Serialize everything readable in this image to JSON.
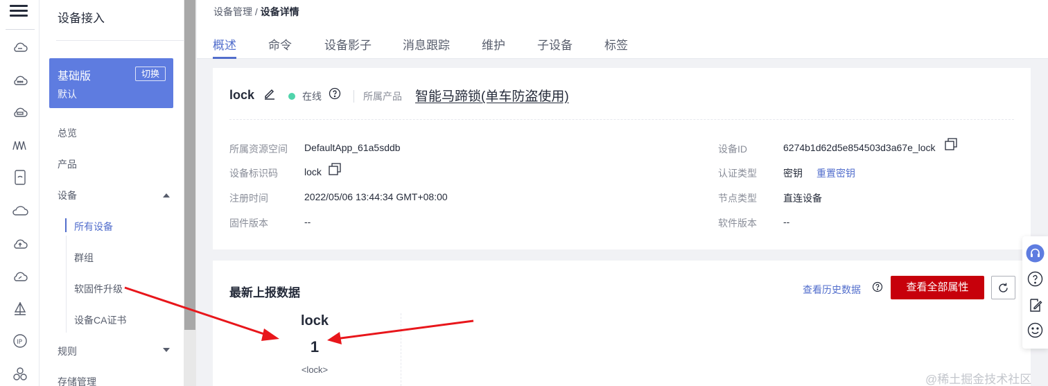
{
  "rail": {
    "icons": [
      "menu-icon",
      "cloud-icon",
      "cloud-dots-icon",
      "cloud-server-icon",
      "wave-icon",
      "device-icon",
      "cloud-outline-icon",
      "cloud-upload-icon",
      "cloud-link-icon",
      "sail-icon",
      "ip-icon",
      "cluster-icon"
    ]
  },
  "menu": {
    "title": "设备接入",
    "edition": {
      "name": "基础版",
      "switch_label": "切换",
      "default_label": "默认"
    },
    "items": [
      {
        "label": "总览"
      },
      {
        "label": "产品"
      },
      {
        "label": "设备"
      },
      {
        "label": "所有设备"
      },
      {
        "label": "群组"
      },
      {
        "label": "软固件升级"
      },
      {
        "label": "设备CA证书"
      },
      {
        "label": "规则"
      },
      {
        "label": "存储管理"
      }
    ]
  },
  "breadcrumb": {
    "parent": "设备管理",
    "separator": "/",
    "current": "设备详情"
  },
  "tabs": [
    {
      "label": "概述",
      "active": true
    },
    {
      "label": "命令"
    },
    {
      "label": "设备影子"
    },
    {
      "label": "消息跟踪"
    },
    {
      "label": "维护"
    },
    {
      "label": "子设备"
    },
    {
      "label": "标签"
    }
  ],
  "device": {
    "name": "lock",
    "status": "在线",
    "status_color": "#50d4ab",
    "product_label": "所属产品",
    "product_name": "智能马蹄锁(单车防盗使用)",
    "fields_left": [
      {
        "label": "所属资源空间",
        "value": "DefaultApp_61a5sddb"
      },
      {
        "label": "设备标识码",
        "value": "lock"
      },
      {
        "label": "注册时间",
        "value": "2022/05/06 13:44:34 GMT+08:00"
      },
      {
        "label": "固件版本",
        "value": "--"
      }
    ],
    "fields_right": [
      {
        "label": "设备ID",
        "value": "6274b1d62d5e854503d3a67e_lock"
      },
      {
        "label": "认证类型",
        "value": "密钥",
        "action": "重置密钥"
      },
      {
        "label": "节点类型",
        "value": "直连设备"
      },
      {
        "label": "软件版本",
        "value": "--"
      }
    ]
  },
  "latest": {
    "title": "最新上报数据",
    "history_link": "查看历史数据",
    "view_all_button": "查看全部属性",
    "property": {
      "name": "lock",
      "value": "1",
      "key": "<lock>"
    }
  },
  "float_toolbar": [
    "headset-icon",
    "help-icon",
    "edit-note-icon",
    "smile-icon"
  ],
  "watermark": "@稀土掘金技术社区",
  "colors": {
    "accent": "#526ecc",
    "primary_button": "#c7000b",
    "edition_bg": "#5e7ce0",
    "annotation_arrow": "#e8161b"
  }
}
